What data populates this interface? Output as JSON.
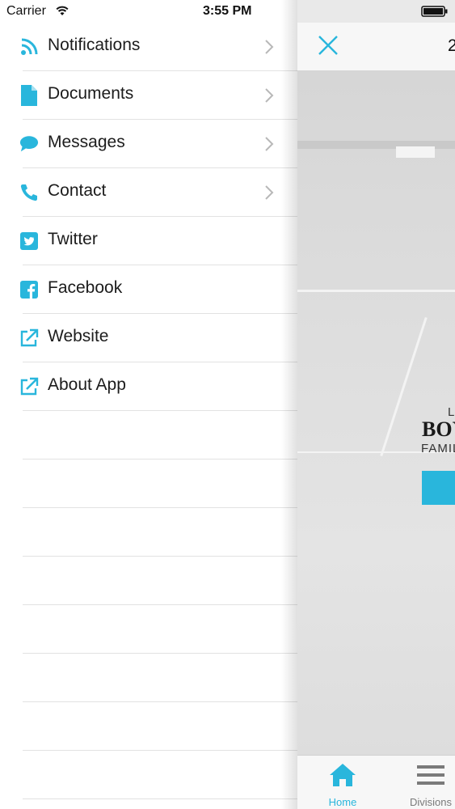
{
  "status_bar": {
    "carrier": "Carrier",
    "time": "3:55 PM"
  },
  "menu": {
    "items": [
      {
        "label": "Notifications",
        "icon": "rss-icon",
        "has_chevron": true
      },
      {
        "label": "Documents",
        "icon": "document-icon",
        "has_chevron": true
      },
      {
        "label": "Messages",
        "icon": "chat-bubble-icon",
        "has_chevron": true
      },
      {
        "label": "Contact",
        "icon": "phone-icon",
        "has_chevron": true
      },
      {
        "label": "Twitter",
        "icon": "twitter-icon",
        "has_chevron": false
      },
      {
        "label": "Facebook",
        "icon": "facebook-icon",
        "has_chevron": false
      },
      {
        "label": "Website",
        "icon": "external-link-icon",
        "has_chevron": false
      },
      {
        "label": "About App",
        "icon": "external-link-icon",
        "has_chevron": false
      }
    ]
  },
  "main": {
    "nav_title": "2",
    "logo": {
      "line1": "L",
      "line2": "BOY",
      "line3": "FAMIL"
    },
    "tabs": [
      {
        "label": "Home",
        "icon": "home-icon",
        "active": true
      },
      {
        "label": "Divisions",
        "icon": "hamburger-menu-icon",
        "active": false
      }
    ]
  },
  "colors": {
    "accent": "#29b6dc",
    "separator": "#e2e2e2",
    "text": "#1c1c1c"
  }
}
